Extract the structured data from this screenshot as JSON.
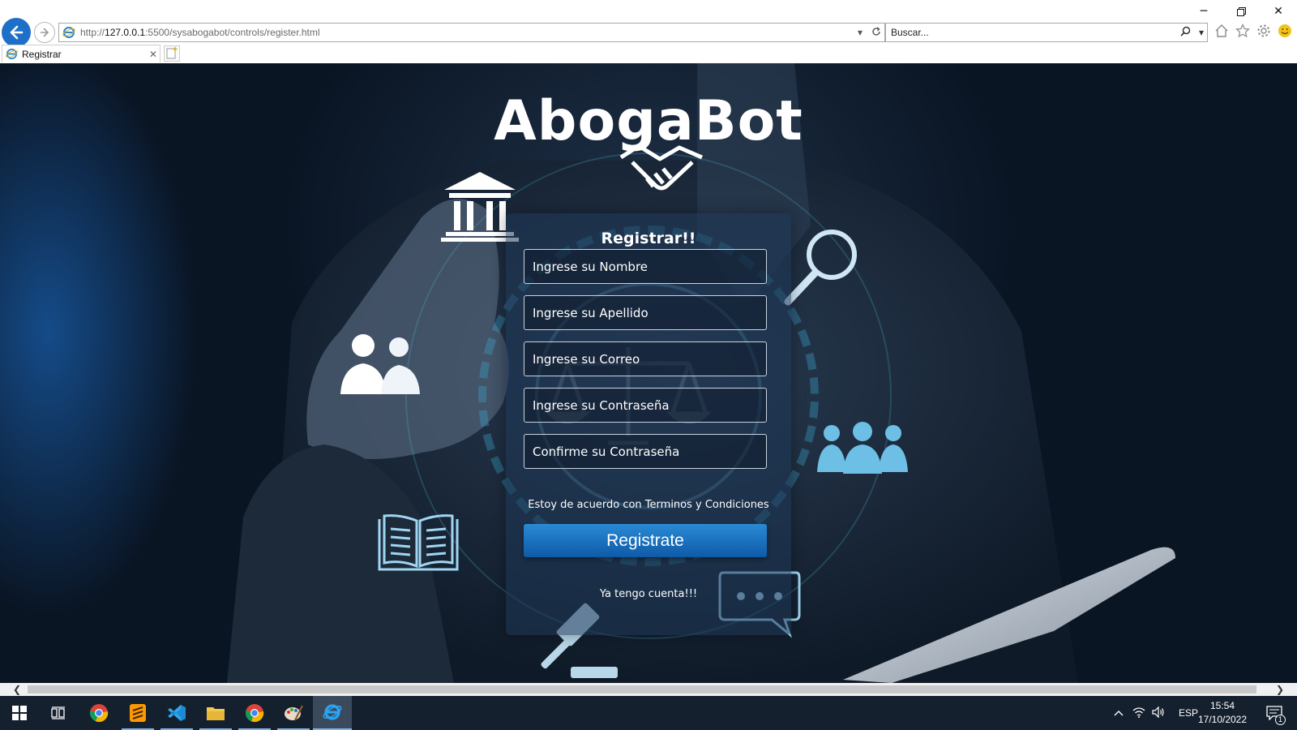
{
  "browser": {
    "url_prefix": "http://",
    "url_host": "127.0.0.1",
    "url_rest": ":5500/sysabogabot/controls/register.html",
    "search_placeholder": "Buscar...",
    "tab_title": "Registrar"
  },
  "page": {
    "app_title": "AbogaBot",
    "form": {
      "title": "Registrar!!",
      "fields": [
        "Ingrese su Nombre",
        "Ingrese su Apellido",
        "Ingrese su Correo",
        "Ingrese su Contraseña",
        "Confirme su Contraseña"
      ],
      "terms_text": "Estoy de acuerdo con Terminos y Condiciones",
      "submit_label": "Registrate",
      "login_link": "Ya tengo cuenta!!!"
    }
  },
  "taskbar": {
    "apps": [
      "windows-start",
      "task-view",
      "chrome",
      "sublime-text",
      "vscode",
      "file-explorer",
      "chrome",
      "paint",
      "internet-explorer"
    ],
    "language": "ESP",
    "time": "15:54",
    "date": "17/10/2022",
    "notification_count": "1"
  },
  "colors": {
    "accent_blue": "#1e6fc8",
    "button_blue": "#1577c4",
    "taskbar": "#14202e"
  }
}
